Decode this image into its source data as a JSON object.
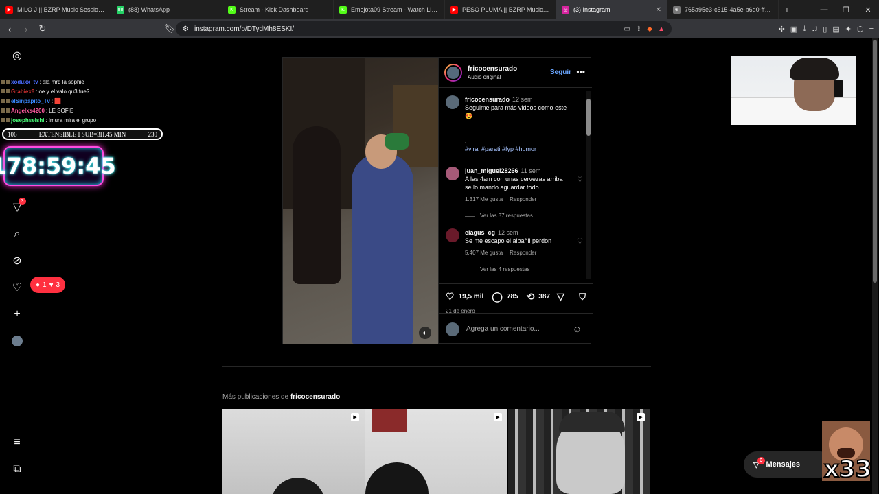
{
  "browser": {
    "tabs": [
      {
        "label": "MILO J || BZRP Music Sessions #57/6",
        "fav_color": "#ff0000",
        "fav_text": "▶",
        "active": false
      },
      {
        "label": "(88) WhatsApp",
        "fav_color": "#25d366",
        "fav_text": "88",
        "active": false
      },
      {
        "label": "Stream - Kick Dashboard",
        "fav_color": "#53fc18",
        "fav_text": "K",
        "active": false
      },
      {
        "label": "Emejota09 Stream - Watch Live on K",
        "fav_color": "#53fc18",
        "fav_text": "K",
        "active": false
      },
      {
        "label": "PESO PLUMA || BZRP Music Session",
        "fav_color": "#ff0000",
        "fav_text": "▶",
        "active": false
      },
      {
        "label": "(3) Instagram",
        "fav_color": "#d6249f",
        "fav_text": "◎",
        "active": true
      },
      {
        "label": "765a95e3-c515-4a5e-b6d0-ff92ffff9",
        "fav_color": "#777777",
        "fav_text": "⊕",
        "active": false
      }
    ],
    "url": "instagram.com/p/DTydMh8ESKI/"
  },
  "overlay": {
    "chat": [
      {
        "user": "xoduxx_tv",
        "msg": "ala mrd la sophie",
        "color": "#4a6cff"
      },
      {
        "user": "Grabiex8",
        "msg": "oe y el valo qu3 fue?",
        "color": "#d03030"
      },
      {
        "user": "elSinpapito_Tv",
        "msg": "🟥",
        "color": "#3a8aff"
      },
      {
        "user": "Angelxs4200",
        "msg": "LE SOFIE",
        "color": "#ff5aa0"
      },
      {
        "user": "josephselshi",
        "msg": "!mura mira el grupo",
        "color": "#4aff7a"
      }
    ],
    "sub_left": "106",
    "sub_center": "EXTENSIBLE I SUB=3H.45 MIN",
    "sub_right": "230",
    "timer": "178:59:45"
  },
  "sidenav": {
    "notif_badge": "3",
    "comments_count": "1",
    "likes_count": "3"
  },
  "post": {
    "username": "fricocensurado",
    "audio": "Audio original",
    "follow_label": "Seguir",
    "caption": {
      "user": "fricocensurado",
      "time": "12 sem",
      "text": "Seguime para más videos como este",
      "dots": ".",
      "hashtags": "#viral #parati #fyp #humor"
    },
    "comments": [
      {
        "user": "juan_miguel28266",
        "time": "11 sem",
        "text": "A las 4am con unas cervezas arriba se lo mando aguardar todo",
        "likes": "1.317 Me gusta",
        "reply": "Responder",
        "replies": "Ver las 37 respuestas"
      },
      {
        "user": "elagus_cg",
        "time": "12 sem",
        "text": "Se me escapo el albañil perdon",
        "likes": "5.407 Me gusta",
        "reply": "Responder",
        "replies": "Ver las 4 respuestas"
      }
    ],
    "likes": "19,5 mil",
    "comments_count": "785",
    "reposts": "387",
    "date": "21 de enero",
    "add_comment_placeholder": "Agrega un comentario..."
  },
  "more_posts": {
    "prefix": "Más publicaciones de",
    "user": "fricocensurado"
  },
  "messages": {
    "label": "Mensajes",
    "badge": "3"
  },
  "emote_text": "x33"
}
